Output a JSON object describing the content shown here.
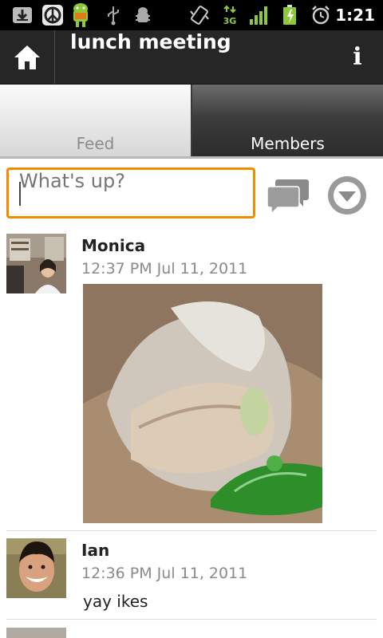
{
  "status_bar": {
    "time": "1:21",
    "icons": [
      "download-icon",
      "peace-app-icon",
      "android-app-icon",
      "usb-icon",
      "usb-debugging-icon",
      "vibrate-icon",
      "3g-data-icon",
      "signal-icon",
      "battery-charging-icon",
      "alarm-icon"
    ]
  },
  "header": {
    "title": "lunch meeting",
    "home_icon": "home-icon",
    "info_label": "i"
  },
  "tabs": [
    {
      "label": "Feed",
      "selected": true
    },
    {
      "label": "Members",
      "selected": false
    }
  ],
  "composer": {
    "placeholder": "What's up?",
    "value": ""
  },
  "colors": {
    "accent": "#f08c00",
    "titlebar": "#262626"
  },
  "posts": [
    {
      "name": "Monica",
      "time": "12:37 PM Jul 11, 2011",
      "has_photo": true,
      "text": ""
    },
    {
      "name": "Ian",
      "time": "12:36 PM Jul 11, 2011",
      "has_photo": false,
      "text": "yay ikes"
    }
  ]
}
